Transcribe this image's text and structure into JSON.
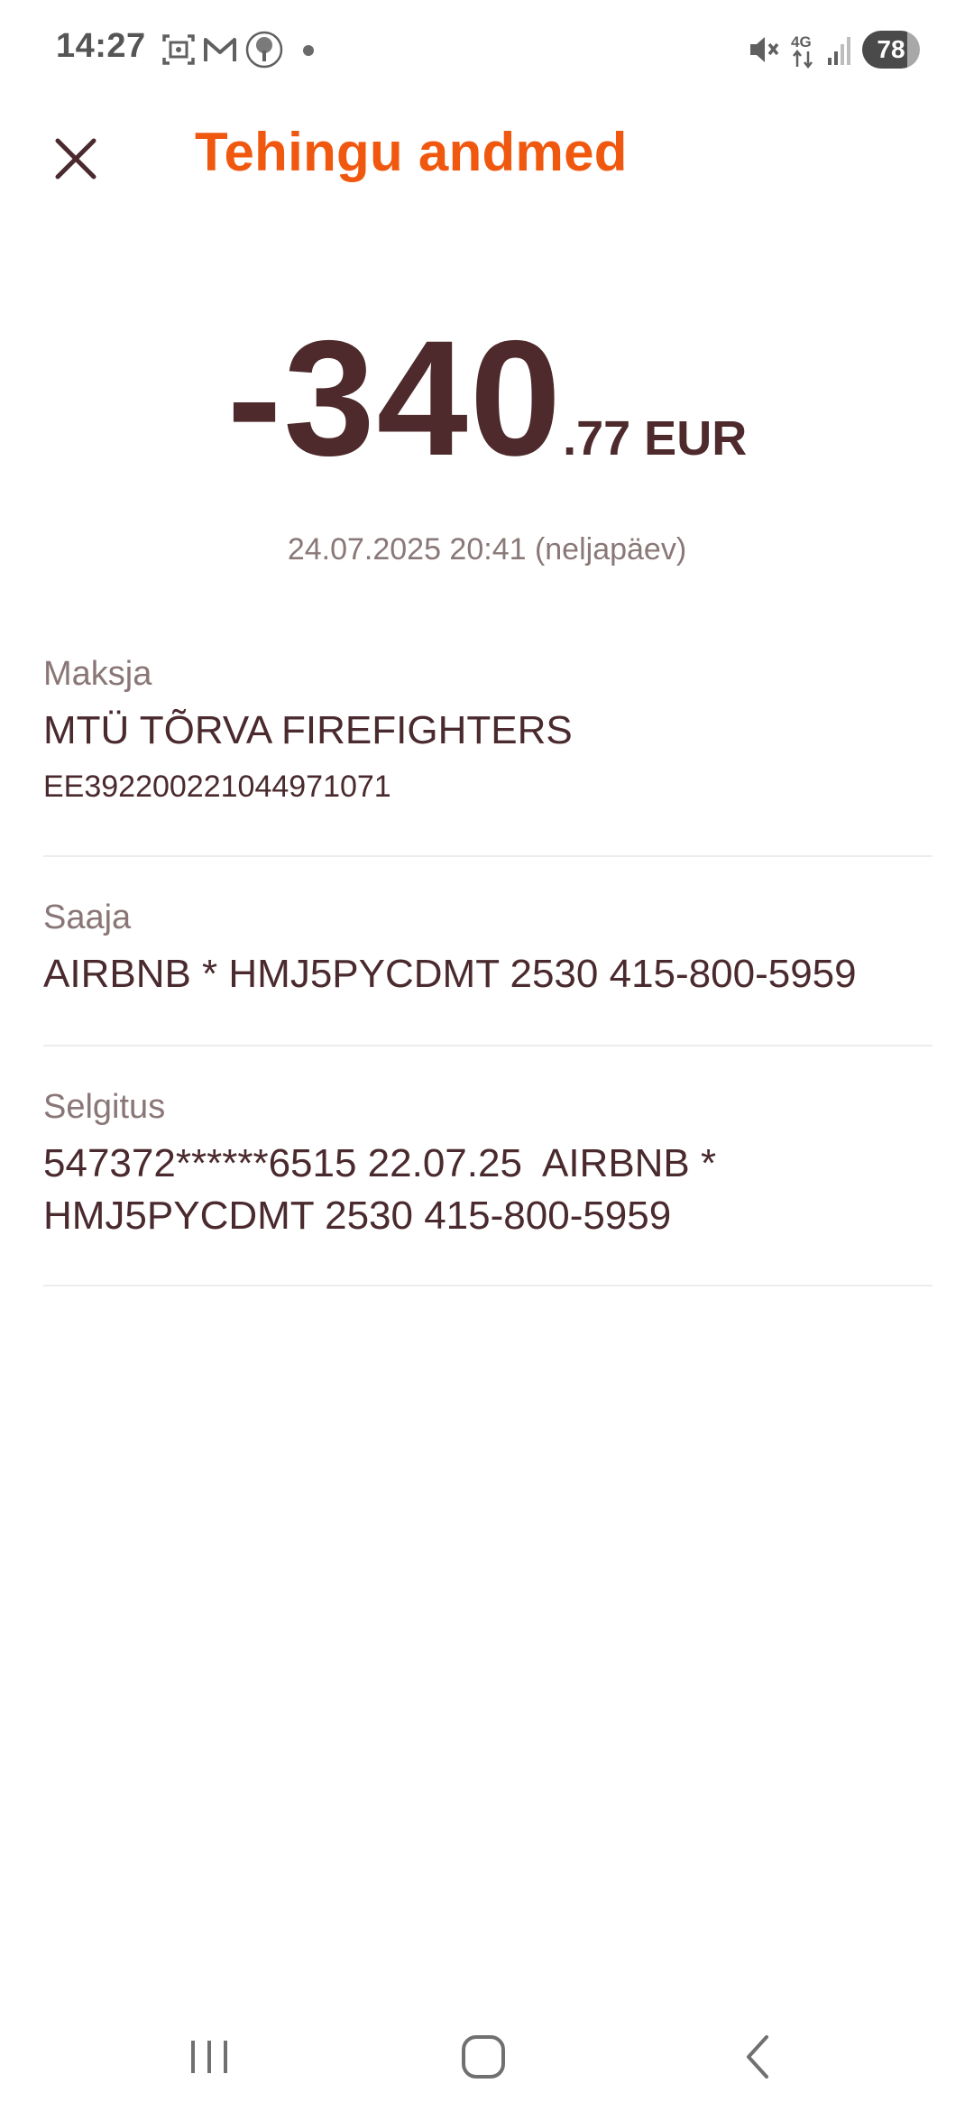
{
  "status_bar": {
    "time": "14:27",
    "battery": "78",
    "network": "4G",
    "icons": [
      "screenshot-icon",
      "gmail-icon",
      "tree-app-icon",
      "notification-dot",
      "mute-icon",
      "4g-icon",
      "signal-icon",
      "battery-icon"
    ]
  },
  "header": {
    "close_icon": "close-icon",
    "title": "Tehingu andmed"
  },
  "transaction": {
    "amount_main": "-340",
    "amount_fraction": ".77",
    "currency": " EUR",
    "datetime": "24.07.2025 20:41 (neljapäev)"
  },
  "details": {
    "payer": {
      "label": "Maksja",
      "name": "MTÜ TÕRVA FIREFIGHTERS",
      "iban": "EE392200221044971071"
    },
    "recipient": {
      "label": "Saaja",
      "name": "AIRBNB * HMJ5PYCDMT 2530 415-800-5959"
    },
    "description": {
      "label": "Selgitus",
      "line1": "547372******6515 22.07.25  AIRBNB *",
      "line2": "HMJ5PYCDMT 2530 415-800-5959"
    }
  },
  "nav_bar": {
    "items": [
      "recent-apps-icon",
      "home-icon",
      "back-icon"
    ]
  },
  "colors": {
    "title": "#f0580f",
    "primary_text": "#4a2a2e",
    "secondary_text": "#8a7676",
    "divider": "#ececec"
  }
}
